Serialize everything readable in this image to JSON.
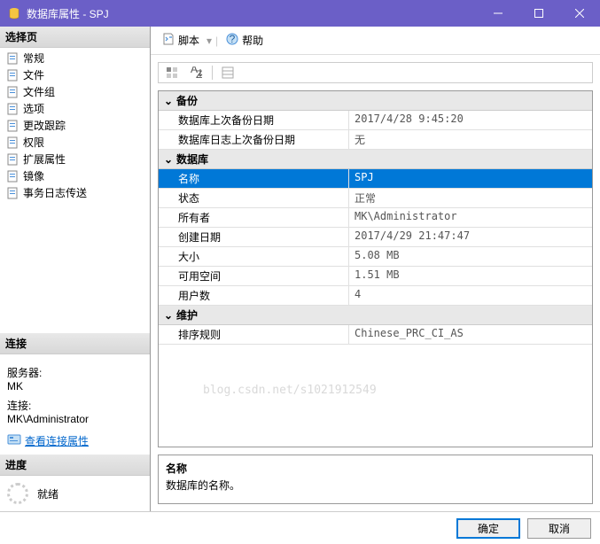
{
  "titlebar": {
    "title": "数据库属性 - SPJ"
  },
  "toolbar": {
    "script": "脚本",
    "help": "帮助"
  },
  "left": {
    "select_page": "选择页",
    "items": [
      {
        "label": "常规"
      },
      {
        "label": "文件"
      },
      {
        "label": "文件组"
      },
      {
        "label": "选项"
      },
      {
        "label": "更改跟踪"
      },
      {
        "label": "权限"
      },
      {
        "label": "扩展属性"
      },
      {
        "label": "镜像"
      },
      {
        "label": "事务日志传送"
      }
    ],
    "connection": {
      "header": "连接",
      "server_label": "服务器:",
      "server_value": "MK",
      "conn_label": "连接:",
      "conn_value": "MK\\Administrator",
      "view_link": "查看连接属性"
    },
    "progress": {
      "header": "进度",
      "status": "就绪"
    }
  },
  "grid": {
    "categories": [
      {
        "name": "备份",
        "rows": [
          {
            "k": "数据库上次备份日期",
            "v": "2017/4/28 9:45:20"
          },
          {
            "k": "数据库日志上次备份日期",
            "v": "无"
          }
        ]
      },
      {
        "name": "数据库",
        "rows": [
          {
            "k": "名称",
            "v": "SPJ",
            "selected": true
          },
          {
            "k": "状态",
            "v": "正常"
          },
          {
            "k": "所有者",
            "v": "MK\\Administrator"
          },
          {
            "k": "创建日期",
            "v": "2017/4/29 21:47:47"
          },
          {
            "k": "大小",
            "v": "5.08 MB"
          },
          {
            "k": "可用空间",
            "v": "1.51 MB"
          },
          {
            "k": "用户数",
            "v": "4"
          }
        ]
      },
      {
        "name": "维护",
        "rows": [
          {
            "k": "排序规则",
            "v": "Chinese_PRC_CI_AS"
          }
        ]
      }
    ]
  },
  "desc": {
    "title": "名称",
    "text": "数据库的名称。"
  },
  "buttons": {
    "ok": "确定",
    "cancel": "取消"
  },
  "watermark": "blog.csdn.net/s1021912549"
}
